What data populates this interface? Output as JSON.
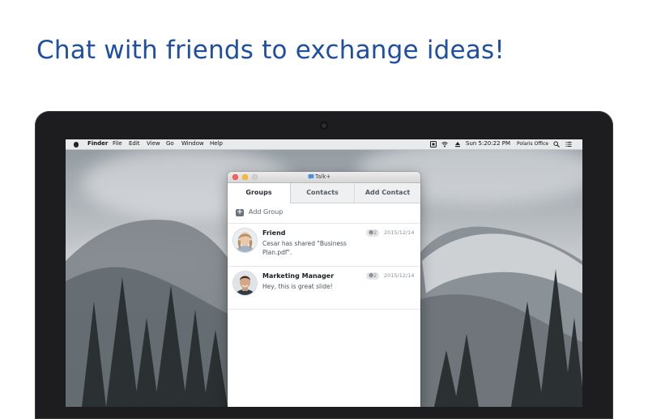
{
  "headline": "Chat with friends to exchange ideas!",
  "menubar": {
    "app_name": "Finder",
    "menus": [
      "File",
      "Edit",
      "View",
      "Go",
      "Window",
      "Help"
    ],
    "clock": "Sun 5:20:22 PM",
    "account": "Polaris Office",
    "icons": [
      "apple-icon",
      "share-icon",
      "wifi-icon",
      "eject-icon",
      "search-icon",
      "list-icon"
    ]
  },
  "window": {
    "title": "Talk+",
    "tabs": [
      "Groups",
      "Contacts",
      "Add Contact"
    ],
    "active_tab": "Groups",
    "add_group_label": "Add Group",
    "conversations": [
      {
        "name": "Friend",
        "message": "Cesar has shared \"Business Plan.pdf\".",
        "member_count": "2",
        "date": "2015/12/14"
      },
      {
        "name": "Marketing Manager",
        "message": "Hey, this is great slide!",
        "member_count": "2",
        "date": "2015/12/14"
      }
    ]
  },
  "colors": {
    "headline": "#1f4fa3",
    "close": "#fc5f57",
    "minimize": "#fdbc2e",
    "zoom": "#d0d0d0"
  }
}
